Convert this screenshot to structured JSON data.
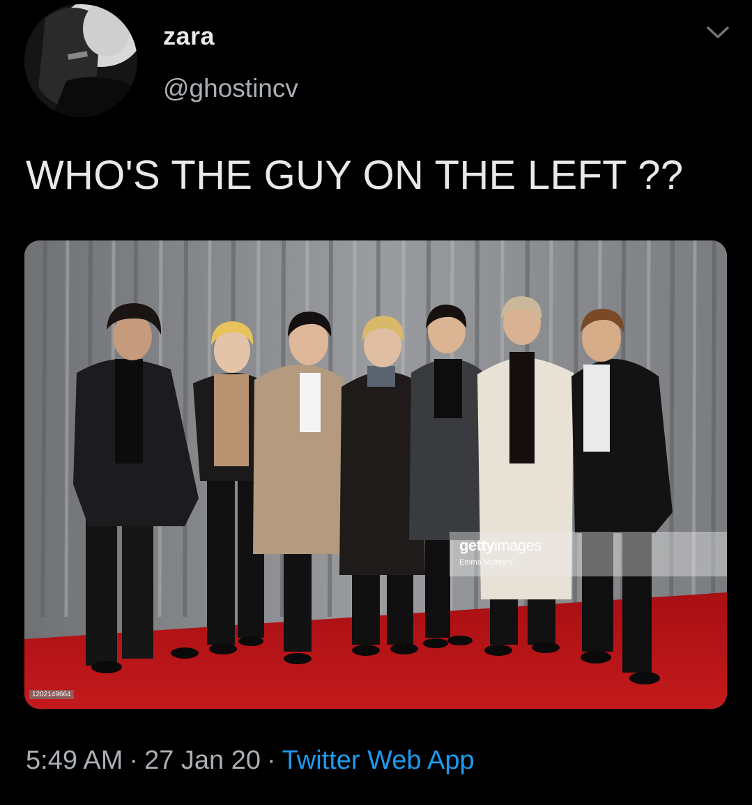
{
  "tweet": {
    "author": {
      "display_name": "zara",
      "handle": "@ghostincv"
    },
    "text": "WHO'S THE GUY ON THE LEFT ??",
    "media": {
      "watermark_brand_bold": "getty",
      "watermark_brand_light": "images",
      "watermark_credit": "Emma McIntyre",
      "image_id": "1202149664"
    },
    "meta": {
      "time": "5:49 AM",
      "separator": "·",
      "date": "27 Jan 20",
      "source": "Twitter Web App"
    }
  },
  "colors": {
    "background": "#000000",
    "text_primary": "#e7e9ea",
    "text_secondary": "#aab0b5",
    "link": "#1d9bf0",
    "carpet": "#b01216",
    "curtain": "#8a8c8f"
  },
  "icons": {
    "menu": "chevron-down-icon"
  }
}
